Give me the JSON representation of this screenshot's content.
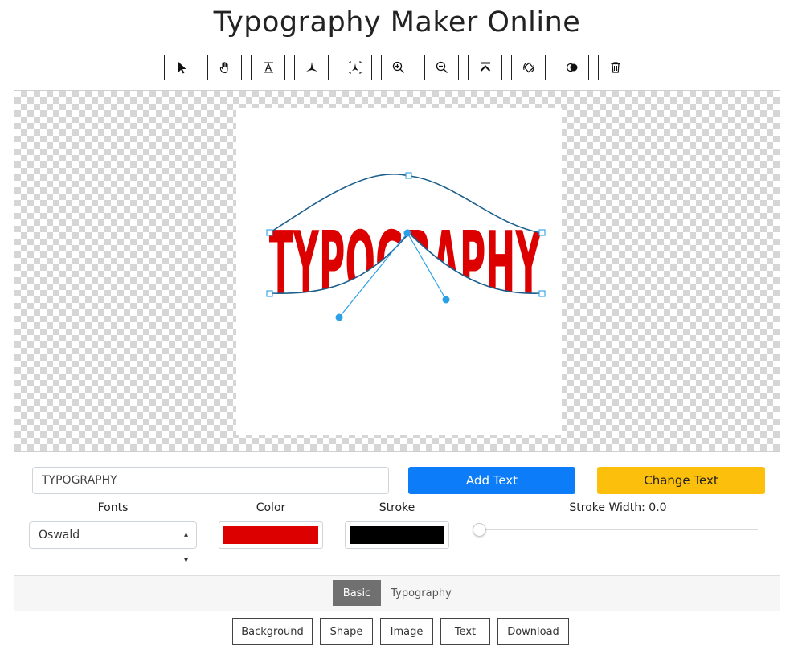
{
  "page": {
    "title": "Typography Maker Online"
  },
  "toolbar": {
    "tools": [
      {
        "name": "pointer-icon"
      },
      {
        "name": "hand-icon"
      },
      {
        "name": "text-transform-icon"
      },
      {
        "name": "warp-icon"
      },
      {
        "name": "envelope-distort-icon"
      },
      {
        "name": "zoom-in-icon"
      },
      {
        "name": "zoom-out-icon"
      },
      {
        "name": "arch-icon"
      },
      {
        "name": "flip-icon"
      },
      {
        "name": "blend-icon"
      },
      {
        "name": "trash-icon"
      }
    ]
  },
  "canvas": {
    "text": "TYPOGRAPHY",
    "text_color": "#dd0000",
    "envelope_color": "#1c5f8c",
    "handle_color": "#2aa0e6"
  },
  "controls": {
    "text_input_value": "TYPOGRAPHY",
    "add_text_label": "Add Text",
    "change_text_label": "Change Text",
    "fonts_label": "Fonts",
    "font_selected": "Oswald",
    "color_label": "Color",
    "color_value": "#dd0000",
    "stroke_label": "Stroke",
    "stroke_value": "#000000",
    "stroke_width_label": "Stroke Width: 0.0",
    "stroke_width": 0.0
  },
  "tabs": {
    "basic": "Basic",
    "typography": "Typography"
  },
  "bottom_nav": {
    "background": "Background",
    "shape": "Shape",
    "image": "Image",
    "text": "Text",
    "download": "Download"
  }
}
